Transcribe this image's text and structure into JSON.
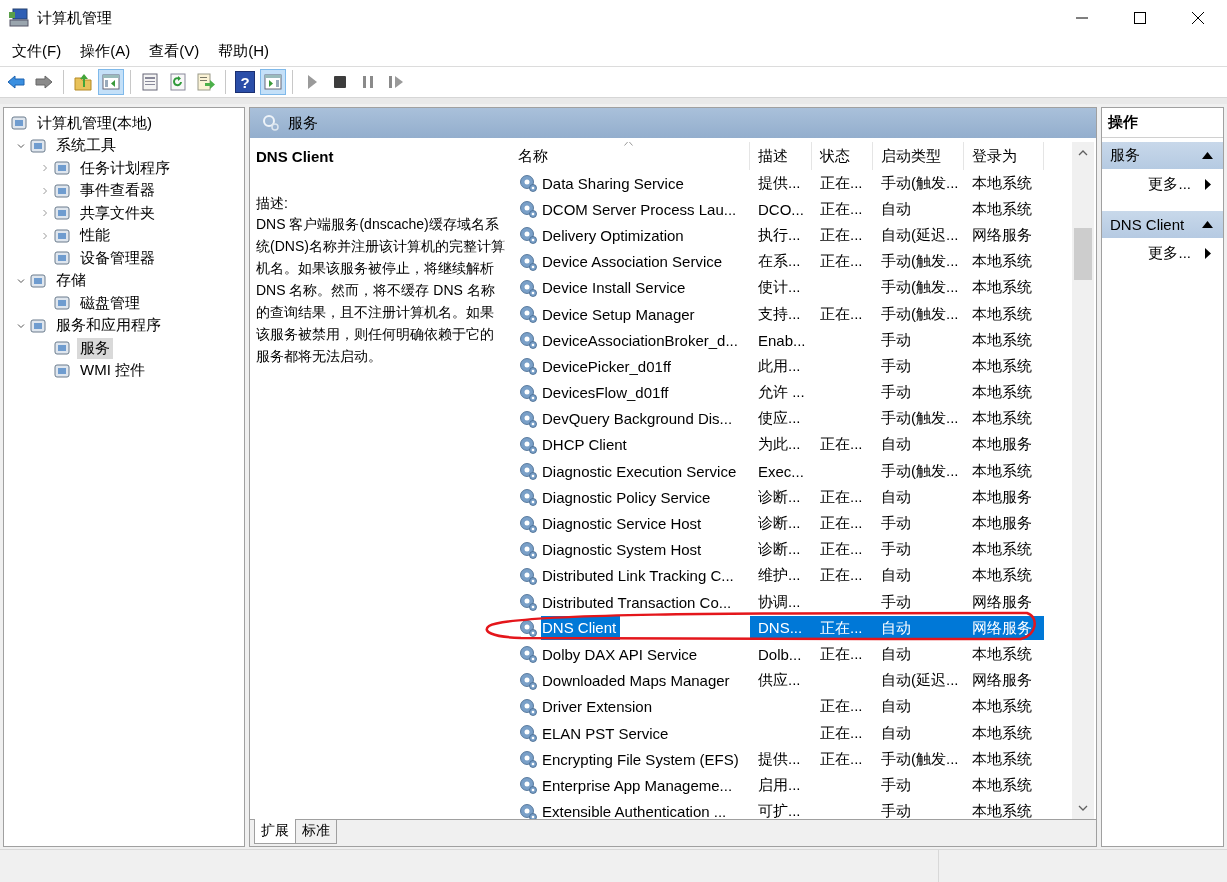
{
  "window": {
    "title": "计算机管理"
  },
  "menu": [
    "文件(F)",
    "操作(A)",
    "查看(V)",
    "帮助(H)"
  ],
  "toolbar": [
    {
      "kind": "back",
      "on": false
    },
    {
      "kind": "forward",
      "on": false
    },
    {
      "kind": "separator"
    },
    {
      "kind": "up-folder",
      "on": false
    },
    {
      "kind": "console-tree",
      "on": true
    },
    {
      "kind": "separator"
    },
    {
      "kind": "properties",
      "on": false
    },
    {
      "kind": "refresh",
      "on": false
    },
    {
      "kind": "export",
      "on": false
    },
    {
      "kind": "separator"
    },
    {
      "kind": "help",
      "label": "?",
      "on": false
    },
    {
      "kind": "action-pane",
      "on": true
    },
    {
      "kind": "separator"
    },
    {
      "kind": "play",
      "on": false
    },
    {
      "kind": "stop",
      "on": false
    },
    {
      "kind": "pause",
      "on": false
    },
    {
      "kind": "resume",
      "on": false
    }
  ],
  "tree": {
    "label": "计算机管理(本地)",
    "selected": false,
    "children": [
      {
        "label": "系统工具",
        "selected": false,
        "expanded": true,
        "children": [
          {
            "label": "任务计划程序",
            "selected": false,
            "expanded": false
          },
          {
            "label": "事件查看器",
            "selected": false,
            "expanded": false
          },
          {
            "label": "共享文件夹",
            "selected": false,
            "expanded": false
          },
          {
            "label": "性能",
            "selected": false,
            "expanded": false
          },
          {
            "label": "设备管理器",
            "selected": false
          }
        ]
      },
      {
        "label": "存储",
        "selected": false,
        "expanded": true,
        "children": [
          {
            "label": "磁盘管理",
            "selected": false
          }
        ]
      },
      {
        "label": "服务和应用程序",
        "selected": false,
        "expanded": true,
        "children": [
          {
            "label": "服务",
            "selected": true
          },
          {
            "label": "WMI 控件",
            "selected": false
          }
        ]
      }
    ]
  },
  "header": {
    "title": "服务"
  },
  "description": {
    "service_name": "DNS Client",
    "label": "描述:",
    "text": "DNS 客户端服务(dnscache)缓存域名系统(DNS)名称并注册该计算机的完整计算机名。如果该服务被停止，将继续解析 DNS 名称。然而，将不缓存 DNS 名称的查询结果，且不注册计算机名。如果该服务被禁用，则任何明确依赖于它的服务都将无法启动。"
  },
  "table": {
    "columns": [
      {
        "label": "名称",
        "sorted": true
      },
      {
        "label": "描述",
        "sorted": false
      },
      {
        "label": "状态",
        "sorted": false
      },
      {
        "label": "启动类型",
        "sorted": false
      },
      {
        "label": "登录为",
        "sorted": false
      }
    ],
    "rows": [
      {
        "name": "Data Sharing Service",
        "description": "提供...",
        "status": "正在...",
        "startup_type": "手动(触发...",
        "log_on_as": "本地系统",
        "selected": false
      },
      {
        "name": "DCOM Server Process Lau...",
        "description": "DCO...",
        "status": "正在...",
        "startup_type": "自动",
        "log_on_as": "本地系统",
        "selected": false
      },
      {
        "name": "Delivery Optimization",
        "description": "执行...",
        "status": "正在...",
        "startup_type": "自动(延迟...",
        "log_on_as": "网络服务",
        "selected": false
      },
      {
        "name": "Device Association Service",
        "description": "在系...",
        "status": "正在...",
        "startup_type": "手动(触发...",
        "log_on_as": "本地系统",
        "selected": false
      },
      {
        "name": "Device Install Service",
        "description": "使计...",
        "startup_type": "手动(触发...",
        "log_on_as": "本地系统",
        "selected": false
      },
      {
        "name": "Device Setup Manager",
        "description": "支持...",
        "status": "正在...",
        "startup_type": "手动(触发...",
        "log_on_as": "本地系统",
        "selected": false
      },
      {
        "name": "DeviceAssociationBroker_d...",
        "description": "Enab...",
        "startup_type": "手动",
        "log_on_as": "本地系统",
        "selected": false
      },
      {
        "name": "DevicePicker_d01ff",
        "description": "此用...",
        "startup_type": "手动",
        "log_on_as": "本地系统",
        "selected": false
      },
      {
        "name": "DevicesFlow_d01ff",
        "description": "允许 ...",
        "startup_type": "手动",
        "log_on_as": "本地系统",
        "selected": false
      },
      {
        "name": "DevQuery Background Dis...",
        "description": "使应...",
        "startup_type": "手动(触发...",
        "log_on_as": "本地系统",
        "selected": false
      },
      {
        "name": "DHCP Client",
        "description": "为此...",
        "status": "正在...",
        "startup_type": "自动",
        "log_on_as": "本地服务",
        "selected": false
      },
      {
        "name": "Diagnostic Execution Service",
        "description": "Exec...",
        "startup_type": "手动(触发...",
        "log_on_as": "本地系统",
        "selected": false
      },
      {
        "name": "Diagnostic Policy Service",
        "description": "诊断...",
        "status": "正在...",
        "startup_type": "自动",
        "log_on_as": "本地服务",
        "selected": false
      },
      {
        "name": "Diagnostic Service Host",
        "description": "诊断...",
        "status": "正在...",
        "startup_type": "手动",
        "log_on_as": "本地服务",
        "selected": false
      },
      {
        "name": "Diagnostic System Host",
        "description": "诊断...",
        "status": "正在...",
        "startup_type": "手动",
        "log_on_as": "本地系统",
        "selected": false
      },
      {
        "name": "Distributed Link Tracking C...",
        "description": "维护...",
        "status": "正在...",
        "startup_type": "自动",
        "log_on_as": "本地系统",
        "selected": false
      },
      {
        "name": "Distributed Transaction Co...",
        "description": "协调...",
        "startup_type": "手动",
        "log_on_as": "网络服务",
        "selected": false
      },
      {
        "name": "DNS Client",
        "description": "DNS...",
        "status": "正在...",
        "startup_type": "自动",
        "log_on_as": "网络服务",
        "selected": true
      },
      {
        "name": "Dolby DAX API Service",
        "description": "Dolb...",
        "status": "正在...",
        "startup_type": "自动",
        "log_on_as": "本地系统",
        "selected": false
      },
      {
        "name": "Downloaded Maps Manager",
        "description": "供应...",
        "startup_type": "自动(延迟...",
        "log_on_as": "网络服务",
        "selected": false
      },
      {
        "name": "Driver Extension",
        "status": "正在...",
        "startup_type": "自动",
        "log_on_as": "本地系统",
        "selected": false
      },
      {
        "name": "ELAN PST Service",
        "status": "正在...",
        "startup_type": "自动",
        "log_on_as": "本地系统",
        "selected": false
      },
      {
        "name": "Encrypting File System (EFS)",
        "description": "提供...",
        "status": "正在...",
        "startup_type": "手动(触发...",
        "log_on_as": "本地系统",
        "selected": false
      },
      {
        "name": "Enterprise App Manageme...",
        "description": "启用...",
        "startup_type": "手动",
        "log_on_as": "本地系统",
        "selected": false
      },
      {
        "name": "Extensible Authentication ...",
        "description": "可扩...",
        "startup_type": "手动",
        "log_on_as": "本地系统",
        "selected": false
      }
    ]
  },
  "tabs": [
    {
      "label": "扩展",
      "selected": true
    },
    {
      "label": "标准",
      "selected": false
    }
  ],
  "actions": {
    "title": "操作",
    "sections": [
      {
        "title": "服务",
        "expanded": true,
        "items": [
          "更多..."
        ]
      },
      {
        "title": "DNS Client",
        "expanded": true,
        "items": [
          "更多..."
        ]
      }
    ]
  }
}
